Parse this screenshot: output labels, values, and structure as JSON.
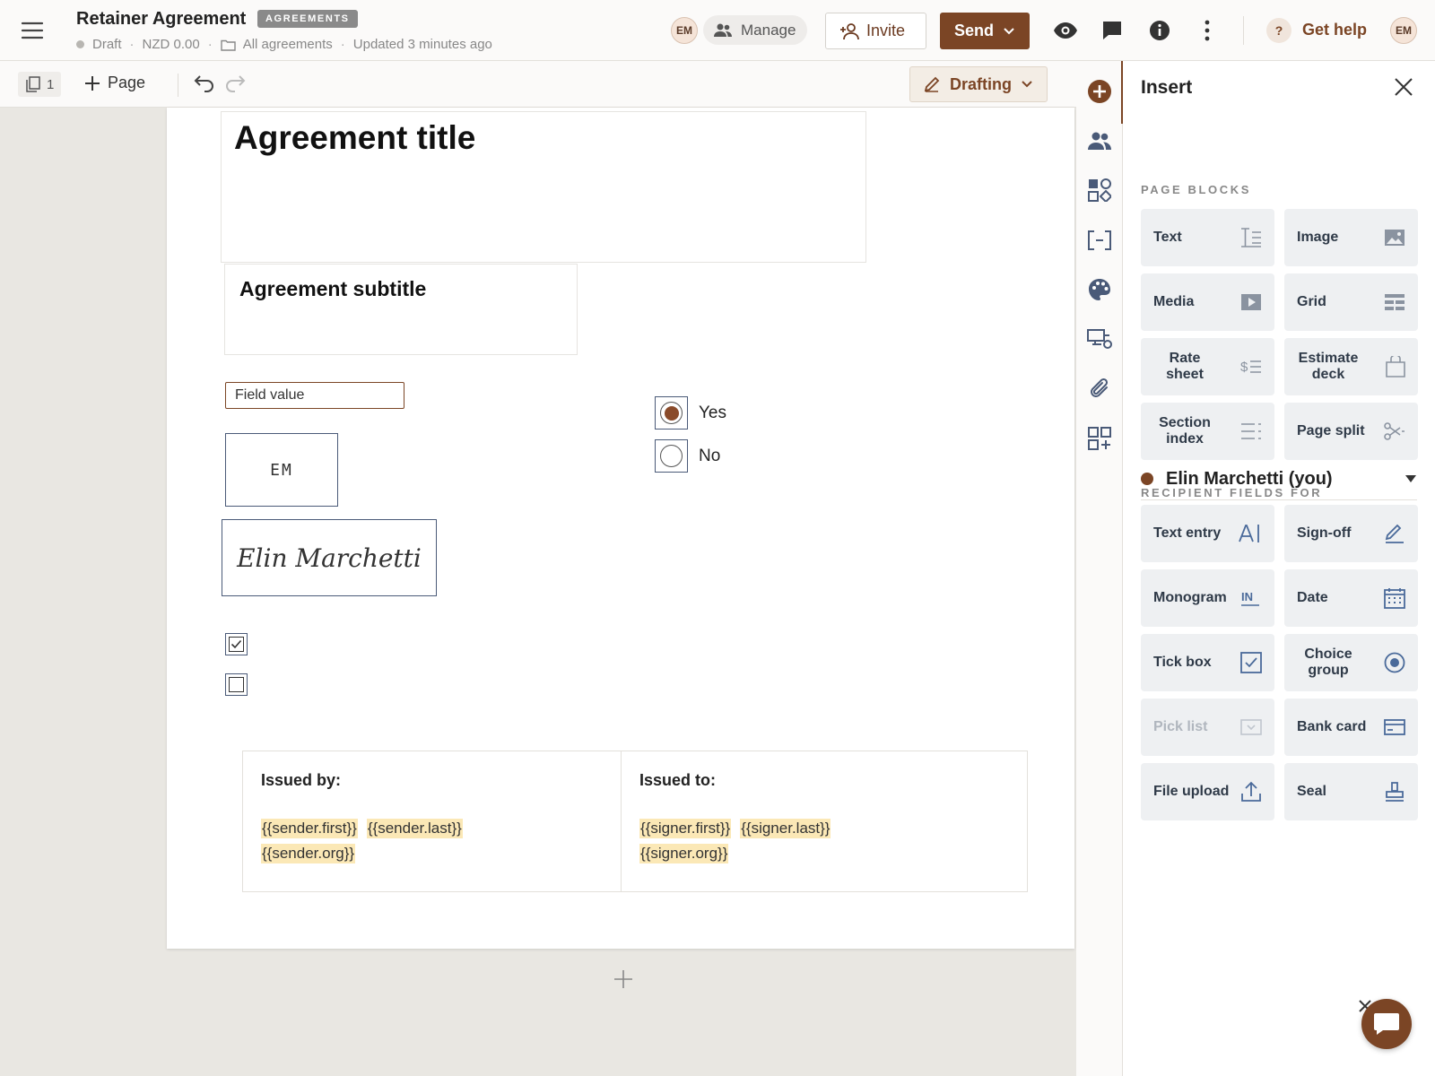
{
  "header": {
    "title": "Retainer Agreement",
    "tag": "AGREEMENTS",
    "status": "Draft",
    "amount": "NZD 0.00",
    "folder": "All agreements",
    "updated": "Updated 3 minutes ago",
    "avatar_initials": "EM",
    "manage_label": "Manage",
    "invite_label": "Invite",
    "send_label": "Send",
    "help_q": "?",
    "help_label": "Get help",
    "user_initials": "EM"
  },
  "toolbar": {
    "page_count": "1",
    "add_page_label": "Page",
    "mode_label": "Drafting"
  },
  "document": {
    "title": "Agreement title",
    "subtitle": "Agreement subtitle",
    "field_value": "Field value",
    "monogram": "EM",
    "signature": "Elin Marchetti",
    "checkbox_1_checked": true,
    "checkbox_2_checked": false,
    "radio_options": [
      {
        "label": "Yes",
        "selected": true
      },
      {
        "label": "No",
        "selected": false
      }
    ],
    "issued_by": {
      "heading": "Issued by:",
      "first": "{{sender.first}}",
      "last": "{{sender.last}}",
      "org": "{{sender.org}}"
    },
    "issued_to": {
      "heading": "Issued to:",
      "first": "{{signer.first}}",
      "last": "{{signer.last}}",
      "org": "{{signer.org}}"
    }
  },
  "panel": {
    "title": "Insert",
    "page_blocks_label": "PAGE BLOCKS",
    "page_blocks": [
      {
        "label": "Text",
        "icon": "text-block-icon"
      },
      {
        "label": "Image",
        "icon": "image-icon"
      },
      {
        "label": "Media",
        "icon": "media-play-icon"
      },
      {
        "label": "Grid",
        "icon": "grid-icon"
      },
      {
        "label": "Rate sheet",
        "icon": "rate-sheet-icon"
      },
      {
        "label": "Estimate deck",
        "icon": "estimate-deck-icon"
      },
      {
        "label": "Section index",
        "icon": "section-index-icon"
      },
      {
        "label": "Page split",
        "icon": "scissors-icon"
      }
    ],
    "recipient_fields_label": "RECIPIENT FIELDS FOR",
    "recipient_name": "Elin Marchetti (you)",
    "recipient_fields": [
      {
        "label": "Text entry",
        "icon": "text-entry-icon",
        "disabled": false
      },
      {
        "label": "Sign-off",
        "icon": "pen-icon",
        "disabled": false
      },
      {
        "label": "Monogram",
        "icon": "monogram-icon",
        "disabled": false
      },
      {
        "label": "Date",
        "icon": "calendar-icon",
        "disabled": false
      },
      {
        "label": "Tick box",
        "icon": "checkbox-icon",
        "disabled": false
      },
      {
        "label": "Choice group",
        "icon": "radio-icon",
        "disabled": false
      },
      {
        "label": "Pick list",
        "icon": "dropdown-icon",
        "disabled": true
      },
      {
        "label": "Bank card",
        "icon": "credit-card-icon",
        "disabled": false
      },
      {
        "label": "File upload",
        "icon": "upload-icon",
        "disabled": false
      },
      {
        "label": "Seal",
        "icon": "stamp-icon",
        "disabled": false
      }
    ]
  },
  "colors": {
    "brand": "#7b4525",
    "tile_bg": "#eef0f2",
    "merge_highlight": "#fbe8b6"
  }
}
